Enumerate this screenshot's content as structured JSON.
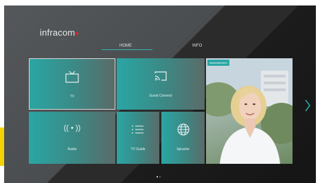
{
  "brand": {
    "name": "infracom",
    "subtext": "·······"
  },
  "tabs": [
    {
      "label": "HOME"
    },
    {
      "label": "INFO"
    }
  ],
  "tiles": [
    {
      "label": "TV"
    },
    {
      "label": "Guest Connect"
    },
    {
      "label": "Radio"
    },
    {
      "label": "TV Guide"
    },
    {
      "label": "Sprache"
    }
  ],
  "ad": {
    "badge": "Advertisement"
  },
  "nav": {
    "next_icon": "chevron-right-icon"
  },
  "pagination": {
    "current": 1,
    "total": 2
  },
  "colors": {
    "accent": "#2aa6a4",
    "brand_dot": "#e3242b",
    "side_bar": "#f4d400"
  }
}
